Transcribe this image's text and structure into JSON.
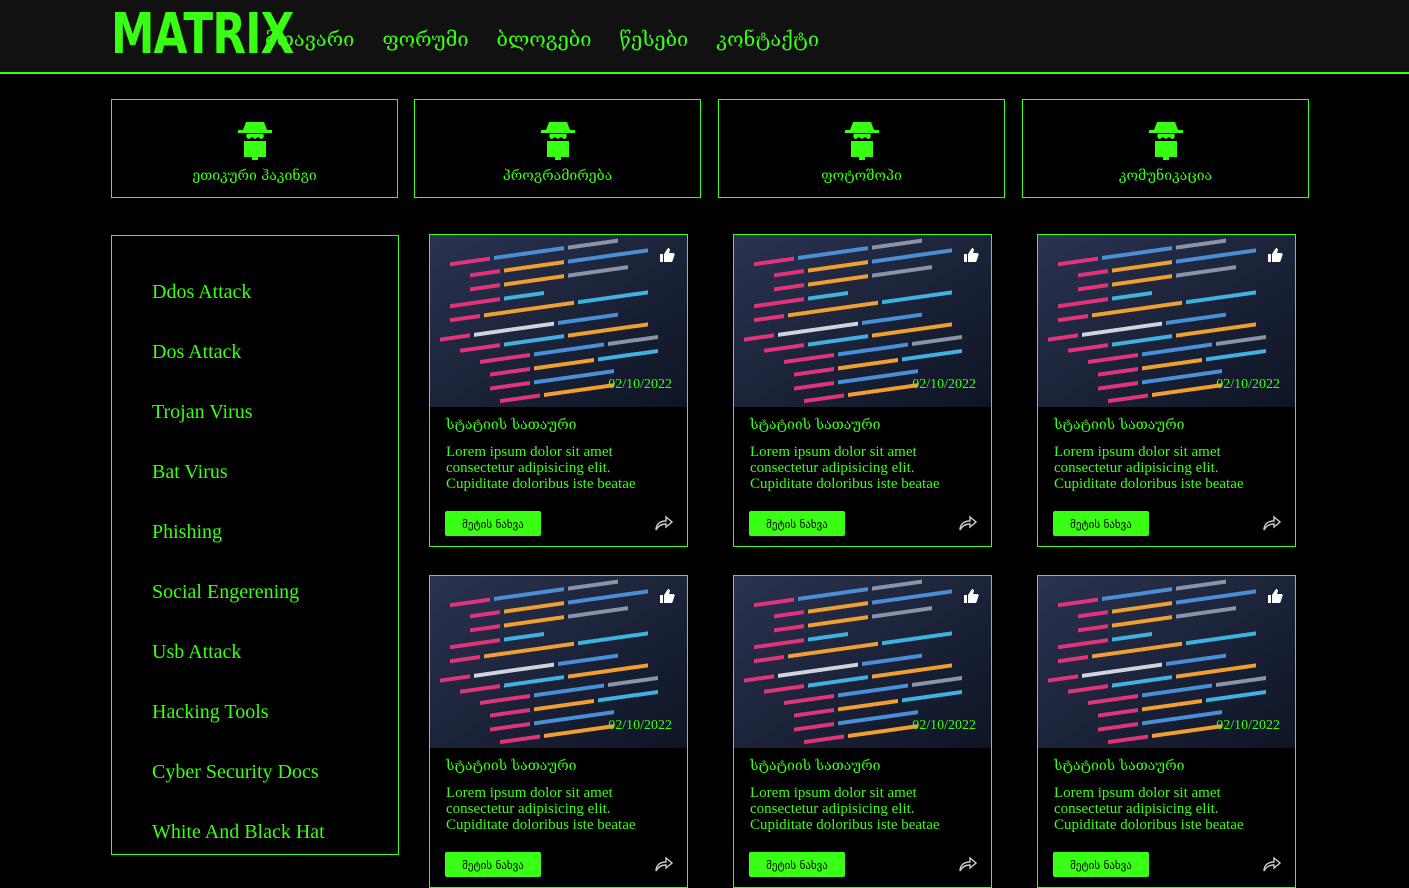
{
  "header": {
    "logo": "MATRIX",
    "nav": [
      "მთავარი",
      "ფორუმი",
      "ბლოგები",
      "წესები",
      "კონტაქტი"
    ]
  },
  "categories": [
    {
      "label": "ეთიკური ჰაკინგი",
      "icon": "hacker-icon"
    },
    {
      "label": "პროგრამირება",
      "icon": "hacker-icon"
    },
    {
      "label": "ფოტოშოპი",
      "icon": "hacker-icon"
    },
    {
      "label": "კომუნიკაცია",
      "icon": "hacker-icon"
    }
  ],
  "sidebar": {
    "items": [
      "Ddos Attack",
      "Dos Attack",
      "Trojan Virus",
      "Bat Virus",
      "Phishing",
      "Social Engerening",
      "Usb Attack",
      "Hacking Tools",
      "Cyber Security Docs",
      "White And Black Hat"
    ]
  },
  "cards": [
    {
      "date": "02/10/2022",
      "title": "სტატიის სათაური",
      "text": "Lorem ipsum dolor sit amet consectetur adipisicing elit. Cupiditate doloribus iste beatae",
      "button": "მეტის ნახვა"
    },
    {
      "date": "02/10/2022",
      "title": "სტატიის სათაური",
      "text": "Lorem ipsum dolor sit amet consectetur adipisicing elit. Cupiditate doloribus iste beatae",
      "button": "მეტის ნახვა"
    },
    {
      "date": "02/10/2022",
      "title": "სტატიის სათაური",
      "text": "Lorem ipsum dolor sit amet consectetur adipisicing elit. Cupiditate doloribus iste beatae",
      "button": "მეტის ნახვა"
    },
    {
      "date": "02/10/2022",
      "title": "სტატიის სათაური",
      "text": "Lorem ipsum dolor sit amet consectetur adipisicing elit. Cupiditate doloribus iste beatae",
      "button": "მეტის ნახვა"
    },
    {
      "date": "02/10/2022",
      "title": "სტატიის სათაური",
      "text": "Lorem ipsum dolor sit amet consectetur adipisicing elit. Cupiditate doloribus iste beatae",
      "button": "მეტის ნახვა"
    },
    {
      "date": "02/10/2022",
      "title": "სტატიის სათაური",
      "text": "Lorem ipsum dolor sit amet consectetur adipisicing elit. Cupiditate doloribus iste beatae",
      "button": "მეტის ნახვა"
    }
  ],
  "colors": {
    "accent": "#39ff14",
    "background": "#000000",
    "header": "#111111"
  }
}
